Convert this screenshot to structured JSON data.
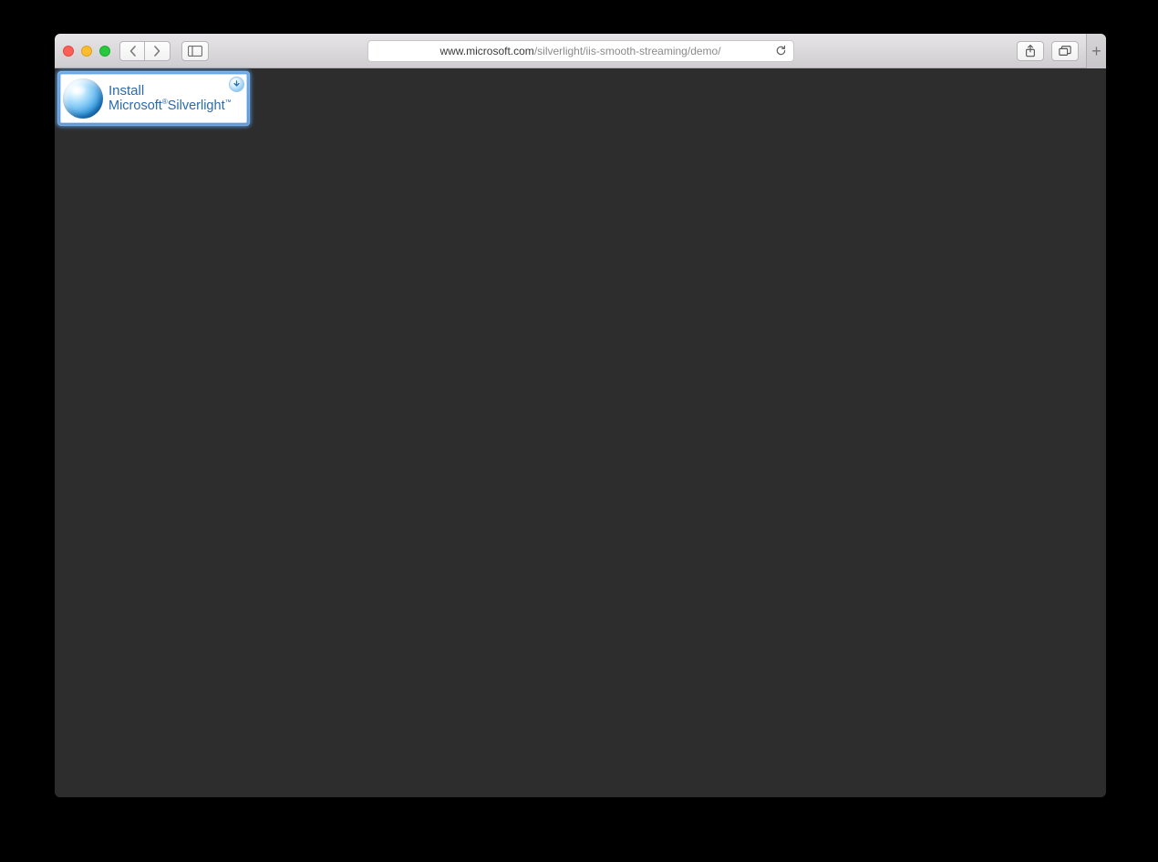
{
  "window": {
    "traffic": {
      "close": "close",
      "minimize": "minimize",
      "zoom": "zoom"
    }
  },
  "toolbar": {
    "back_label": "Back",
    "forward_label": "Forward",
    "sidebar_label": "Show Sidebar",
    "share_label": "Share",
    "tabs_label": "Show All Tabs",
    "newtab_label": "+",
    "reload_label": "Reload"
  },
  "address": {
    "host": "www.microsoft.com",
    "path": "/silverlight/iis-smooth-streaming/demo/"
  },
  "page": {
    "silverlight_badge": {
      "line1": "Install",
      "brand": "Microsoft",
      "product": "Silverlight",
      "reg": "®",
      "tm": "™",
      "download_icon": "download-arrow"
    }
  },
  "colors": {
    "page_bg": "#2d2d2d",
    "badge_border": "#5b97d7",
    "badge_text": "#2b6aad"
  }
}
